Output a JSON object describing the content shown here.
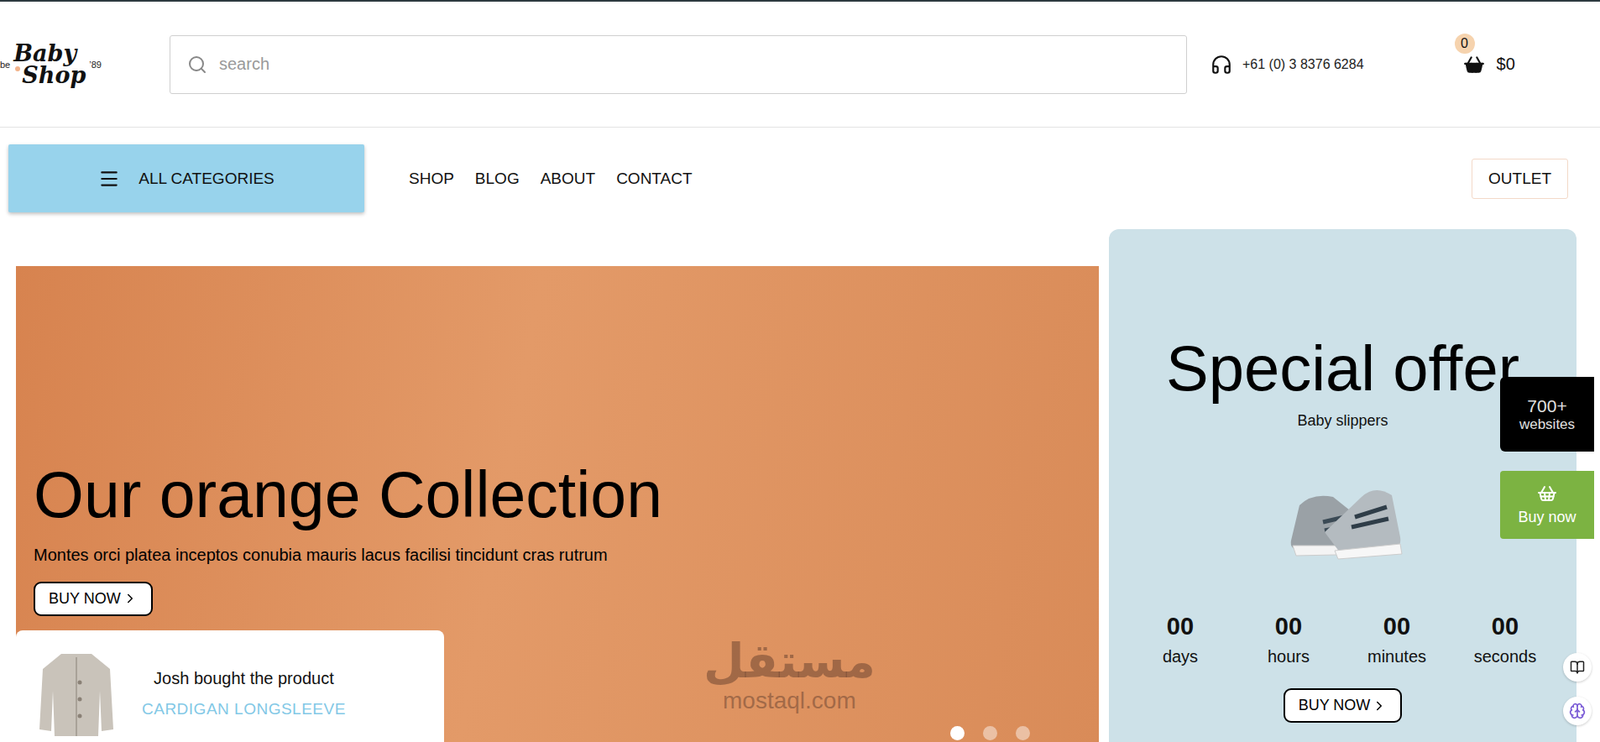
{
  "logo": {
    "prefix": "be",
    "line1": "Baby",
    "line2": "Shop",
    "suffix": "’89"
  },
  "search": {
    "placeholder": "search"
  },
  "phone": "+61 (0) 3 8376 6284",
  "cart": {
    "count": "0",
    "total": "$0"
  },
  "categories_button": "ALL CATEGORIES",
  "nav": [
    "SHOP",
    "BLOG",
    "ABOUT",
    "CONTACT"
  ],
  "outlet": "OUTLET",
  "hero": {
    "title": "Our orange Collection",
    "subtitle": "Montes orci platea inceptos conubia mauris lacus facilisi tincidunt cras rutrum",
    "button": "BUY NOW",
    "slides": [
      {
        "selected": true
      },
      {
        "selected": false
      },
      {
        "selected": false
      }
    ]
  },
  "notification": {
    "text": "Josh bought the product",
    "product": "CARDIGAN LONGSLEEVE"
  },
  "watermark": {
    "arabic": "مستقل",
    "latin": "mostaql.com"
  },
  "offer": {
    "title": "Special offer",
    "subtitle": "Baby slippers",
    "countdown": [
      {
        "value": "00",
        "unit": "days"
      },
      {
        "value": "00",
        "unit": "hours"
      },
      {
        "value": "00",
        "unit": "minutes"
      },
      {
        "value": "00",
        "unit": "seconds"
      }
    ],
    "button": "BUY NOW"
  },
  "side_widgets": {
    "sites_count": "700+",
    "sites_label": "websites",
    "buy": "Buy now"
  }
}
